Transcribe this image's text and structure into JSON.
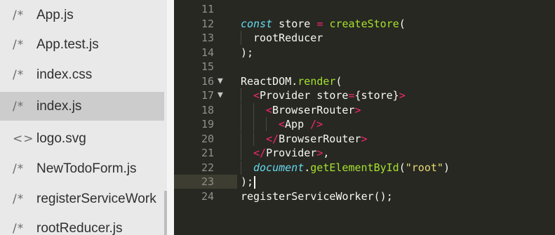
{
  "sidebar": {
    "files": [
      {
        "icon": "/*",
        "icon_name": "js-comment-icon",
        "name": "App.js",
        "active": false
      },
      {
        "icon": "/*",
        "icon_name": "js-comment-icon",
        "name": "App.test.js",
        "active": false
      },
      {
        "icon": "/*",
        "icon_name": "js-comment-icon",
        "name": "index.css",
        "active": false
      },
      {
        "icon": "/*",
        "icon_name": "js-comment-icon",
        "name": "index.js",
        "active": true
      },
      {
        "icon": "<>",
        "icon_name": "markup-icon",
        "name": "logo.svg",
        "active": false
      },
      {
        "icon": "/*",
        "icon_name": "js-comment-icon",
        "name": "NewTodoForm.js",
        "active": false
      },
      {
        "icon": "/*",
        "icon_name": "js-comment-icon",
        "name": "registerServiceWork",
        "active": false
      },
      {
        "icon": "/*",
        "icon_name": "js-comment-icon",
        "name": "rootReducer.js",
        "active": false
      }
    ]
  },
  "editor": {
    "theme_colors": {
      "background": "#272822",
      "keyword": "#66d9ef",
      "function": "#a6e22e",
      "operator": "#f92672",
      "string": "#e6db74",
      "text": "#f8f8f2"
    },
    "current_line": "23",
    "lines": [
      {
        "number": "11",
        "fold": "",
        "indent": 0,
        "tokens": []
      },
      {
        "number": "12",
        "fold": "",
        "indent": 0,
        "tokens": [
          {
            "t": "const",
            "c": "t-kw"
          },
          {
            "t": " store ",
            "c": "t-plain"
          },
          {
            "t": "=",
            "c": "t-op"
          },
          {
            "t": " ",
            "c": "t-plain"
          },
          {
            "t": "createStore",
            "c": "t-fn"
          },
          {
            "t": "(",
            "c": "t-punct"
          }
        ]
      },
      {
        "number": "13",
        "fold": "",
        "indent": 1,
        "tokens": [
          {
            "t": "rootReducer",
            "c": "t-plain"
          }
        ]
      },
      {
        "number": "14",
        "fold": "",
        "indent": 0,
        "tokens": [
          {
            "t": ");",
            "c": "t-punct"
          }
        ]
      },
      {
        "number": "15",
        "fold": "",
        "indent": 0,
        "tokens": []
      },
      {
        "number": "16",
        "fold": "▼",
        "indent": 0,
        "tokens": [
          {
            "t": "ReactDOM",
            "c": "t-plain"
          },
          {
            "t": ".",
            "c": "t-punct"
          },
          {
            "t": "render",
            "c": "t-fn"
          },
          {
            "t": "(",
            "c": "t-punct"
          }
        ]
      },
      {
        "number": "17",
        "fold": "▼",
        "indent": 1,
        "tokens": [
          {
            "t": "<",
            "c": "t-tag"
          },
          {
            "t": "Provider",
            "c": "t-plain"
          },
          {
            "t": " store",
            "c": "t-plain"
          },
          {
            "t": "=",
            "c": "t-op"
          },
          {
            "t": "{store}",
            "c": "t-plain"
          },
          {
            "t": ">",
            "c": "t-tag"
          }
        ]
      },
      {
        "number": "18",
        "fold": "",
        "indent": 2,
        "tokens": [
          {
            "t": "<",
            "c": "t-tag"
          },
          {
            "t": "BrowserRouter",
            "c": "t-plain"
          },
          {
            "t": ">",
            "c": "t-tag"
          }
        ]
      },
      {
        "number": "19",
        "fold": "",
        "indent": 3,
        "tokens": [
          {
            "t": "<",
            "c": "t-tag"
          },
          {
            "t": "App",
            "c": "t-plain"
          },
          {
            "t": " />",
            "c": "t-tag"
          }
        ]
      },
      {
        "number": "20",
        "fold": "",
        "indent": 2,
        "tokens": [
          {
            "t": "</",
            "c": "t-tag"
          },
          {
            "t": "BrowserRouter",
            "c": "t-plain"
          },
          {
            "t": ">",
            "c": "t-tag"
          }
        ]
      },
      {
        "number": "21",
        "fold": "",
        "indent": 1,
        "tokens": [
          {
            "t": "</",
            "c": "t-tag"
          },
          {
            "t": "Provider",
            "c": "t-plain"
          },
          {
            "t": ">",
            "c": "t-tag"
          },
          {
            "t": ",",
            "c": "t-punct"
          }
        ]
      },
      {
        "number": "22",
        "fold": "",
        "indent": 1,
        "tokens": [
          {
            "t": "document",
            "c": "t-obj"
          },
          {
            "t": ".",
            "c": "t-punct"
          },
          {
            "t": "getElementById",
            "c": "t-fn"
          },
          {
            "t": "(",
            "c": "t-punct"
          },
          {
            "t": "\"root\"",
            "c": "t-str"
          },
          {
            "t": ")",
            "c": "t-punct"
          }
        ]
      },
      {
        "number": "23",
        "fold": "",
        "indent": 0,
        "cursor": true,
        "tokens": [
          {
            "t": ");",
            "c": "t-punct"
          }
        ]
      },
      {
        "number": "24",
        "fold": "",
        "indent": 0,
        "tokens": [
          {
            "t": "registerServiceWorker();",
            "c": "t-plain"
          }
        ]
      }
    ]
  }
}
